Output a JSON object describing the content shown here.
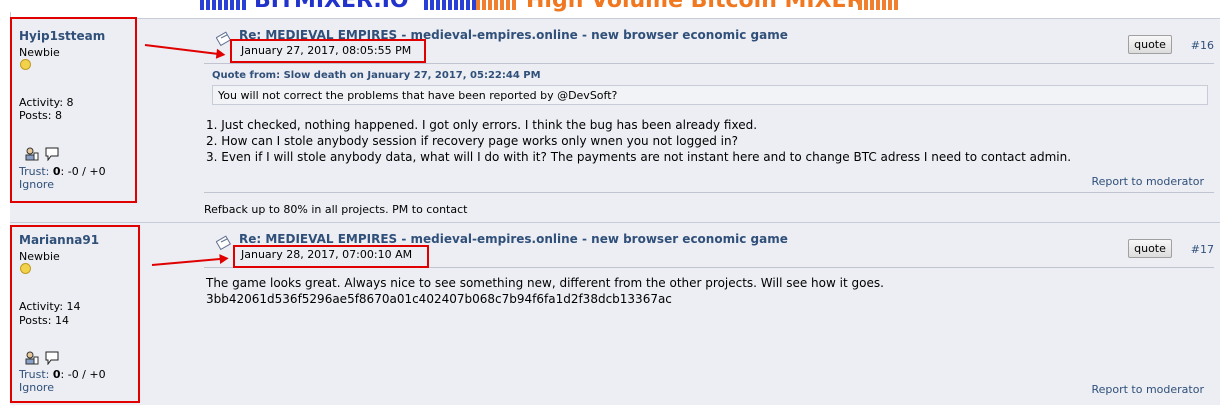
{
  "banner": {
    "text_left": "BITMIXER.IO",
    "text_right": "High Volume Bitcoin MIXER"
  },
  "posts": [
    {
      "author": {
        "name": "Hyip1stteam",
        "rank": "Newbie",
        "activity": "Activity: 8",
        "posts": "Posts: 8",
        "trust_label": "Trust:",
        "trust_score": "0",
        "trust_values": ": -0 / +0",
        "ignore": "Ignore"
      },
      "subject": "Re: MEDIEVAL EMPIRES - medieval-empires.online - new browser economic game",
      "date": "January 27, 2017, 08:05:55 PM",
      "quote_label": "quote",
      "number": "#16",
      "quote_header": "Quote from: Slow death on January 27, 2017, 05:22:44 PM",
      "quote_text": "You will not correct the problems that have been reported by @DevSoft?",
      "lines": [
        "1. Just checked, nothing happened. I got only errors. I think the bug has been already fixed.",
        "2. How can I stole anybody session if recovery page works only wnen you not logged in?",
        "3. Even if I will stole anybody data, what will I do with it? The payments are not instant here and to change BTC adress I need to contact admin."
      ],
      "report": "Report to moderator",
      "signature": "Refback up to 80% in all projects. PM to contact"
    },
    {
      "author": {
        "name": "Marianna91",
        "rank": "Newbie",
        "activity": "Activity: 14",
        "posts": "Posts: 14",
        "trust_label": "Trust:",
        "trust_score": "0",
        "trust_values": ": -0 / +0",
        "ignore": "Ignore"
      },
      "subject": "Re: MEDIEVAL EMPIRES - medieval-empires.online - new browser economic game",
      "date": "January 28, 2017, 07:00:10 AM",
      "quote_label": "quote",
      "number": "#17",
      "lines": [
        "The game looks great. Always nice to see something new, different from the other projects. Will see how it goes.",
        "3bb42061d536f5296ae5f8670a01c402407b068c7b94f6fa1d2f38dcb13367ac"
      ],
      "report": "Report to moderator"
    }
  ],
  "colors": {
    "link": "#30507a",
    "post_bg": "#eceef3",
    "highlight": "#e00000"
  }
}
